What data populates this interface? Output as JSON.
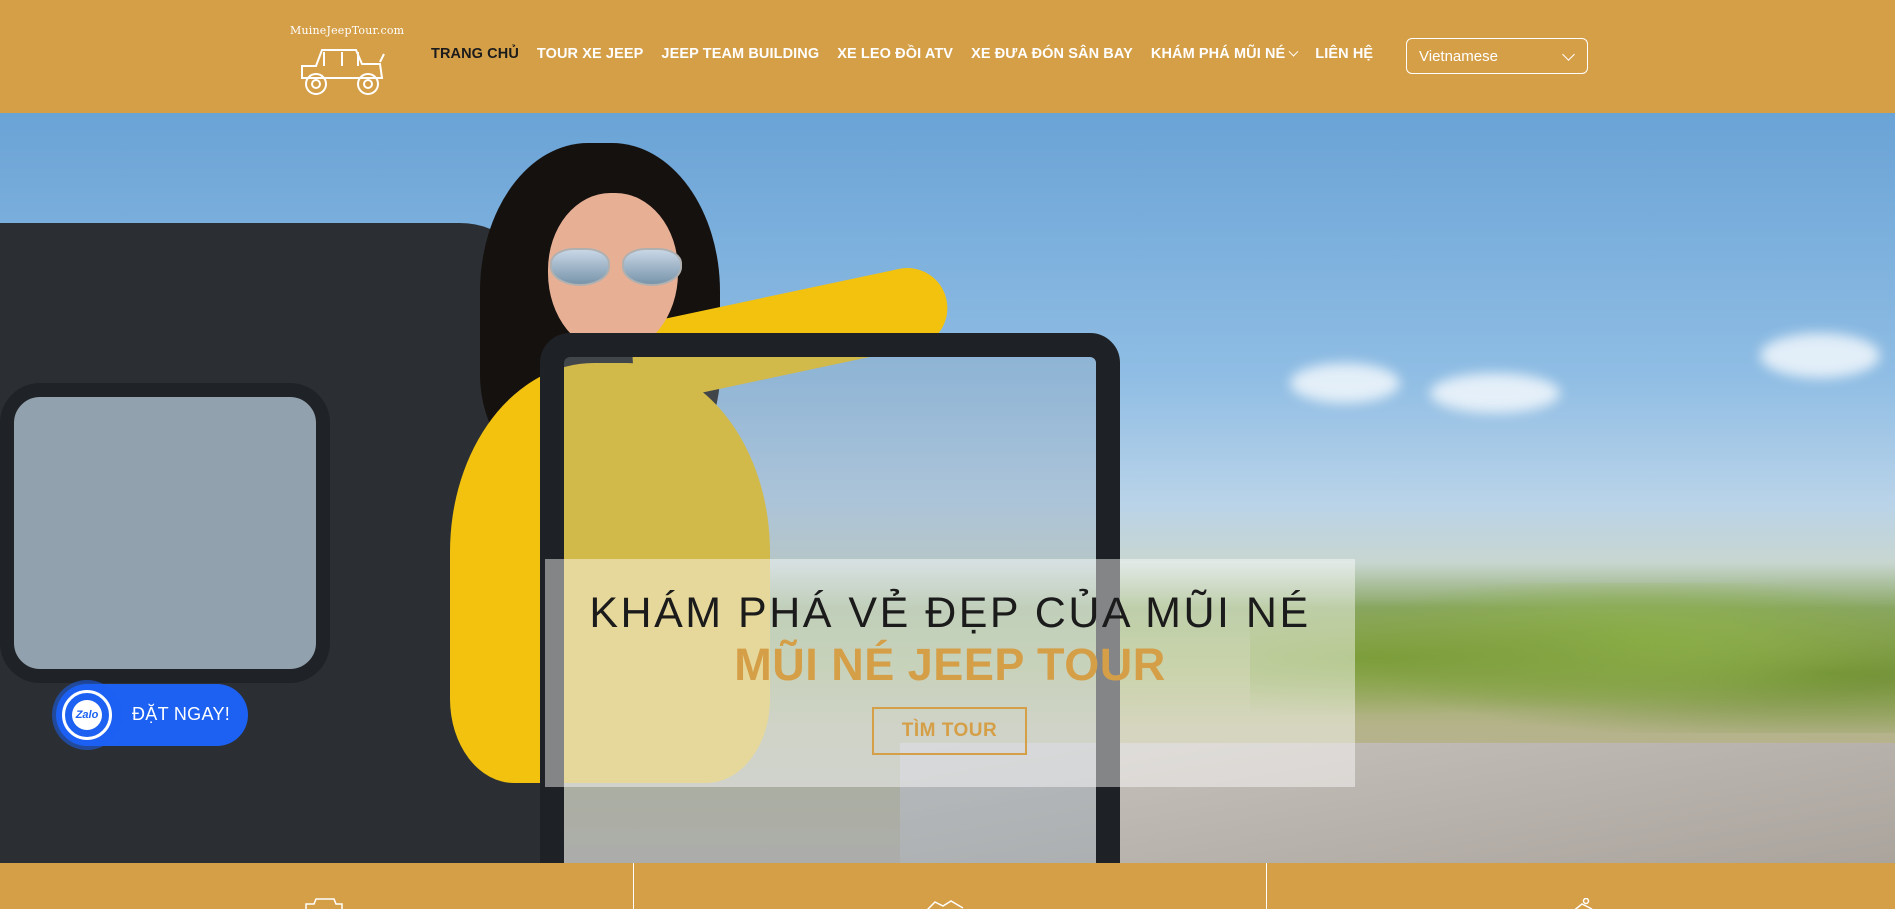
{
  "header": {
    "logo_text": "MuineJeepTour.com",
    "nav": [
      {
        "label": "TRANG CHỦ",
        "active": true
      },
      {
        "label": "TOUR XE JEEP"
      },
      {
        "label": "JEEP TEAM BUILDING"
      },
      {
        "label": "XE LEO ĐỒI ATV"
      },
      {
        "label": "XE ĐƯA ĐÓN SÂN BAY"
      },
      {
        "label": "KHÁM PHÁ MŨI NÉ",
        "has_dropdown": true
      },
      {
        "label": "LIÊN HỆ"
      }
    ],
    "language_select": {
      "value": "Vietnamese"
    }
  },
  "hero": {
    "title": "KHÁM PHÁ VẺ ĐẸP CỦA MŨI NÉ",
    "subtitle": "MŨI NÉ JEEP TOUR",
    "button_label": "TÌM TOUR"
  },
  "zalo_widget": {
    "icon_text": "Zalo",
    "label": "ĐẶT NGAY!"
  },
  "colors": {
    "brand": "#d59f48",
    "dark_text": "#1b1b1b",
    "zalo_blue": "#1c61f2"
  },
  "icons": [
    "jeep-logo-icon",
    "chevron-down-icon",
    "jeep-feature-icon",
    "handshake-feature-icon",
    "hiker-feature-icon"
  ]
}
